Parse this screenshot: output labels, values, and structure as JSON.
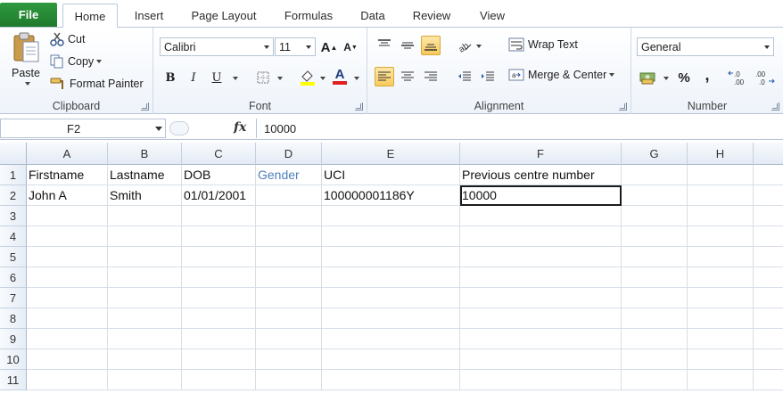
{
  "ribbon_tabs": {
    "file": "File",
    "items": [
      "Home",
      "Insert",
      "Page Layout",
      "Formulas",
      "Data",
      "Review",
      "View"
    ],
    "active": "Home"
  },
  "clipboard": {
    "label": "Clipboard",
    "paste": "Paste",
    "cut": "Cut",
    "copy": "Copy",
    "format_painter": "Format Painter"
  },
  "font": {
    "label": "Font",
    "family": "Calibri",
    "size": "11",
    "bold": "B",
    "italic": "I",
    "underline": "U",
    "font_color_letter": "A"
  },
  "alignment": {
    "label": "Alignment",
    "wrap_text": "Wrap Text",
    "merge_center": "Merge & Center"
  },
  "number": {
    "label": "Number",
    "format": "General",
    "percent": "%",
    "comma": ","
  },
  "formula_bar": {
    "name_box": "F2",
    "fx": "fx",
    "content": "10000"
  },
  "sheet": {
    "columns": [
      "A",
      "B",
      "C",
      "D",
      "E",
      "F",
      "G",
      "H"
    ],
    "rows": [
      "1",
      "2",
      "3",
      "4",
      "5",
      "6",
      "7",
      "8",
      "9",
      "10",
      "11"
    ],
    "cells": {
      "A1": "Firstname",
      "B1": "Lastname",
      "C1": "DOB",
      "D1": "Gender",
      "E1": "UCI",
      "F1": "Previous centre number",
      "A2": "John A",
      "B2": "Smith",
      "C2": "01/01/2001",
      "E2": "100000001186Y",
      "F2": "10000"
    },
    "selected_cell": "F2"
  },
  "colors": {
    "file_tab": "#217a2d",
    "accent_highlight": "#f8ca5c",
    "gender_header_text": "#4f81bd"
  }
}
